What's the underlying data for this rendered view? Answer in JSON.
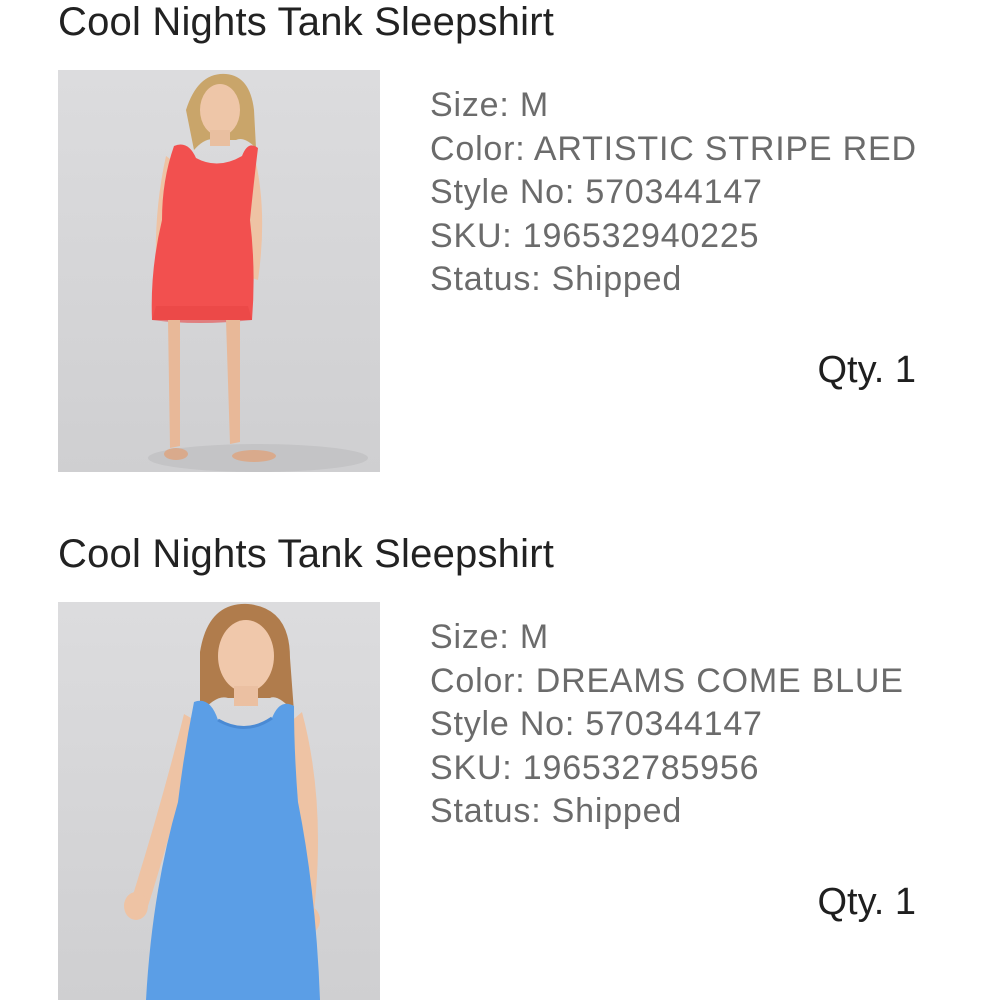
{
  "items": [
    {
      "title": "Cool Nights Tank Sleepshirt",
      "image_icon": "product-photo-red-sleepshirt",
      "dress_color": "#f2504f",
      "size": "Size: M",
      "color": "Color: ARTISTIC STRIPE RED",
      "style_no": "Style No: 570344147",
      "sku": "SKU: 196532940225",
      "status": "Status: Shipped",
      "qty": "Qty. 1"
    },
    {
      "title": "Cool Nights Tank Sleepshirt",
      "image_icon": "product-photo-blue-sleepshirt",
      "dress_color": "#5b9ee6",
      "size": "Size: M",
      "color": "Color: DREAMS COME BLUE",
      "style_no": "Style No: 570344147",
      "sku": "SKU: 196532785956",
      "status": "Status: Shipped",
      "qty": "Qty. 1"
    }
  ]
}
